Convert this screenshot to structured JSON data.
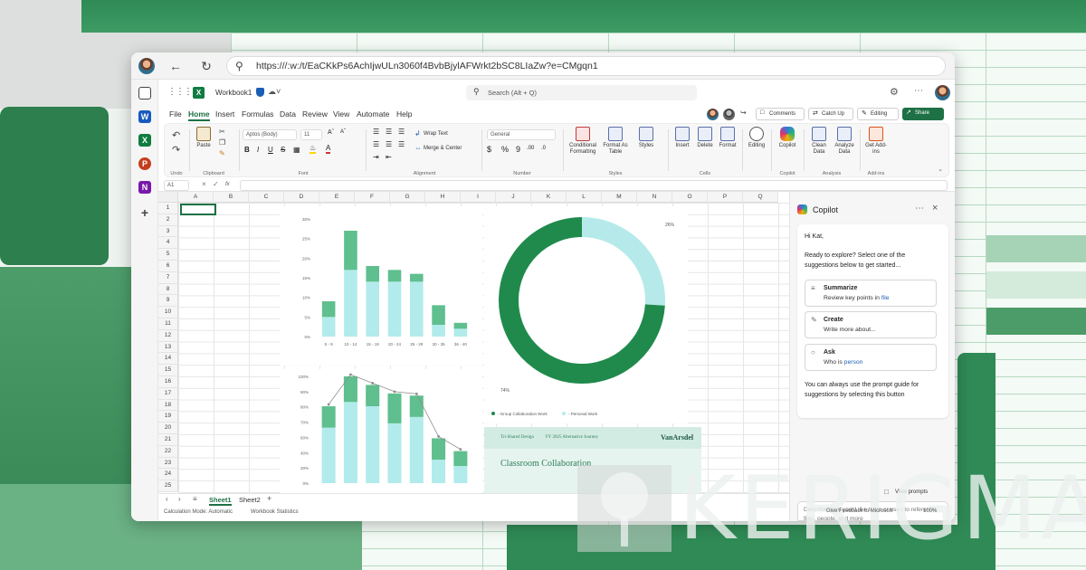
{
  "browser": {
    "url": "https:///:w:/t/EaCKkPs6AchIjwULn3060f4BvbBjylAFWrkt2bSC8LIaZw?e=CMgqn1"
  },
  "app": {
    "workbook_name": "Workbook1",
    "search_placeholder": "Search (Alt + Q)",
    "menu": [
      "File",
      "Home",
      "Insert",
      "Formulas",
      "Data",
      "Review",
      "View",
      "Automate",
      "Help"
    ],
    "active_menu": "Home",
    "comments_label": "Comments",
    "catchup_label": "Catch Up",
    "editing_label": "Editing",
    "share_label": "Share"
  },
  "ribbon": {
    "undo_label": "Undo",
    "paste_label": "Paste",
    "clipboard_label": "Clipboard",
    "font_name": "Aptos (Body)",
    "font_size": "11",
    "font_label": "Font",
    "wrap_text_label": "Wrap Text",
    "merge_label": "Merge & Center",
    "alignment_label": "Alignment",
    "number_format": "General",
    "number_label": "Number",
    "conditional_label": "Conditional Formatting",
    "format_table_label": "Format As Table",
    "styles_btn_label": "Styles",
    "styles_label": "Styles",
    "insert_label": "Insert",
    "delete_label": "Delete",
    "format_label": "Format",
    "cells_label": "Cells",
    "editing_btn_label": "Editing",
    "copilot_btn_label": "Copilot",
    "copilot_group_label": "Copilot",
    "clean_data_label": "Clean Data",
    "analyze_data_label": "Analyze Data",
    "analysis_label": "Analysis",
    "addins_btn_label": "Get Add-ins",
    "addins_label": "Add-ins"
  },
  "formula_bar": {
    "name_box": "A1",
    "fx": "fx"
  },
  "grid": {
    "columns": [
      "A",
      "B",
      "C",
      "D",
      "E",
      "F",
      "G",
      "H",
      "I",
      "J",
      "K",
      "L",
      "M",
      "N",
      "O",
      "P",
      "Q"
    ],
    "rows": [
      "1",
      "2",
      "3",
      "4",
      "5",
      "6",
      "7",
      "8",
      "9",
      "10",
      "11",
      "12",
      "13",
      "14",
      "15",
      "16",
      "17",
      "18",
      "19",
      "20",
      "21",
      "22",
      "23",
      "24",
      "25"
    ]
  },
  "chart_data": [
    {
      "type": "bar",
      "stacked": true,
      "categories": [
        "5 - 9",
        "10 - 14",
        "15 - 19",
        "20 - 24",
        "25 - 29",
        "30 - 35",
        "36 - 40"
      ],
      "series": [
        {
          "values": [
            5,
            17,
            14,
            14,
            14,
            3,
            2
          ]
        },
        {
          "values": [
            4,
            10,
            4,
            3,
            2,
            5,
            1.5
          ]
        }
      ],
      "yticks": [
        "0%",
        "5%",
        "10%",
        "15%",
        "20%",
        "25%",
        "30%"
      ],
      "ylim": [
        0,
        30
      ],
      "colors": [
        "#b2ebeb",
        "#5fbf8e"
      ]
    },
    {
      "type": "donut",
      "values": [
        74,
        26
      ],
      "labels": [
        "74%",
        "26%"
      ],
      "legend": [
        "Group Collaboration Work",
        "Personal Work"
      ],
      "colors": [
        "#1f8a4c",
        "#b6eaea"
      ]
    },
    {
      "type": "bar",
      "stacked": true,
      "with_line": true,
      "series": [
        {
          "values": [
            52,
            76,
            72,
            56,
            62,
            22,
            16
          ]
        },
        {
          "values": [
            20,
            24,
            20,
            28,
            20,
            20,
            14
          ]
        }
      ],
      "yticks": [
        "0%",
        "20%",
        "40%",
        "60%",
        "70%",
        "80%",
        "90%",
        "100%"
      ],
      "colors": [
        "#b2ebeb",
        "#5fbf8e"
      ]
    }
  ],
  "promo_card": {
    "left": "Tri-Shared Design",
    "middle": "FY 2025 Alternative Journey",
    "brand": "VanArsdel",
    "title": "Classroom Collaboration"
  },
  "copilot": {
    "title": "Copilot",
    "greeting": "Hi Kat,",
    "intro": "Ready to explore? Select one of the suggestions below to get started...",
    "suggestions": [
      {
        "title": "Summarize",
        "desc_pre": "Review key points in ",
        "desc_link": "file"
      },
      {
        "title": "Create",
        "desc_pre": "Write more about...",
        "desc_link": ""
      },
      {
        "title": "Ask",
        "desc_pre": "Who is ",
        "desc_link": "person"
      }
    ],
    "hint": "You can always use the prompt guide for suggestions by selecting this button",
    "view_prompts": "View prompts",
    "input_placeholder": "Describe what you'd like to do or use / to reference files, people, and more"
  },
  "sheets": {
    "tabs": [
      "Sheet1",
      "Sheet2"
    ],
    "active": "Sheet1",
    "calc_mode": "Calculation Mode: Automatic",
    "stats": "Workbook Statistics",
    "feedback": "Give Feedback to Microsoft",
    "zoom": "100%"
  },
  "watermark": {
    "text": "KERIGMA"
  },
  "colors": {
    "excel_green": "#1e7145",
    "accent_bg": "#2f8a55"
  }
}
